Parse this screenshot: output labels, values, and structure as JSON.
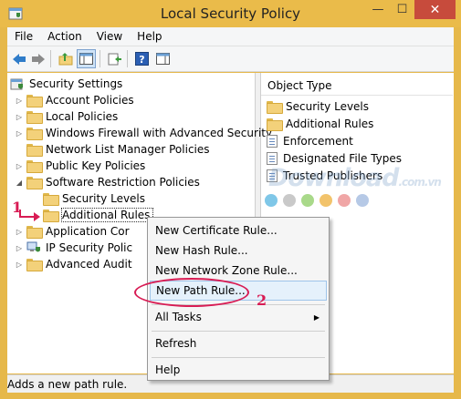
{
  "window": {
    "title": "Local Security Policy",
    "minimize": "—",
    "maximize": "☐",
    "close": "✕"
  },
  "menu": [
    "File",
    "Action",
    "View",
    "Help"
  ],
  "tree": {
    "root": "Security Settings",
    "items": [
      {
        "label": "Account Policies",
        "expander": "▷"
      },
      {
        "label": "Local Policies",
        "expander": "▷"
      },
      {
        "label": "Windows Firewall with Advanced Security",
        "expander": "▷"
      },
      {
        "label": "Network List Manager Policies",
        "expander": ""
      },
      {
        "label": "Public Key Policies",
        "expander": "▷"
      },
      {
        "label": "Software Restriction Policies",
        "expander": "◢"
      },
      {
        "label": "Security Levels",
        "expander": ""
      },
      {
        "label": "Additional Rules",
        "expander": ""
      },
      {
        "label": "Application Cor",
        "expander": "▷"
      },
      {
        "label": "IP Security Polic",
        "expander": "▷"
      },
      {
        "label": "Advanced Audit",
        "expander": "▷"
      }
    ]
  },
  "list": {
    "header": "Object Type",
    "items": [
      {
        "label": "Security Levels",
        "icon": "folder-icon"
      },
      {
        "label": "Additional Rules",
        "icon": "folder-icon"
      },
      {
        "label": "Enforcement",
        "icon": "policy-icon"
      },
      {
        "label": "Designated File Types",
        "icon": "policy-icon"
      },
      {
        "label": "Trusted Publishers",
        "icon": "policy-icon"
      }
    ]
  },
  "context_menu": {
    "items": [
      "New Certificate Rule...",
      "New Hash Rule...",
      "New Network Zone Rule...",
      "New Path Rule...",
      "All Tasks",
      "Refresh",
      "Help"
    ],
    "submenu_arrow": "▶"
  },
  "status": "Adds a new path rule.",
  "watermark": {
    "text": "Download",
    "suffix": ".com.vn"
  },
  "annotations": {
    "step1": "1",
    "step2": "2"
  },
  "colors": {
    "accent": "#d81c54",
    "dots": [
      "#7fc7e8",
      "#c9c9c9",
      "#a9d98a",
      "#f2c36b",
      "#f0a6a6",
      "#b6c9e6"
    ]
  }
}
